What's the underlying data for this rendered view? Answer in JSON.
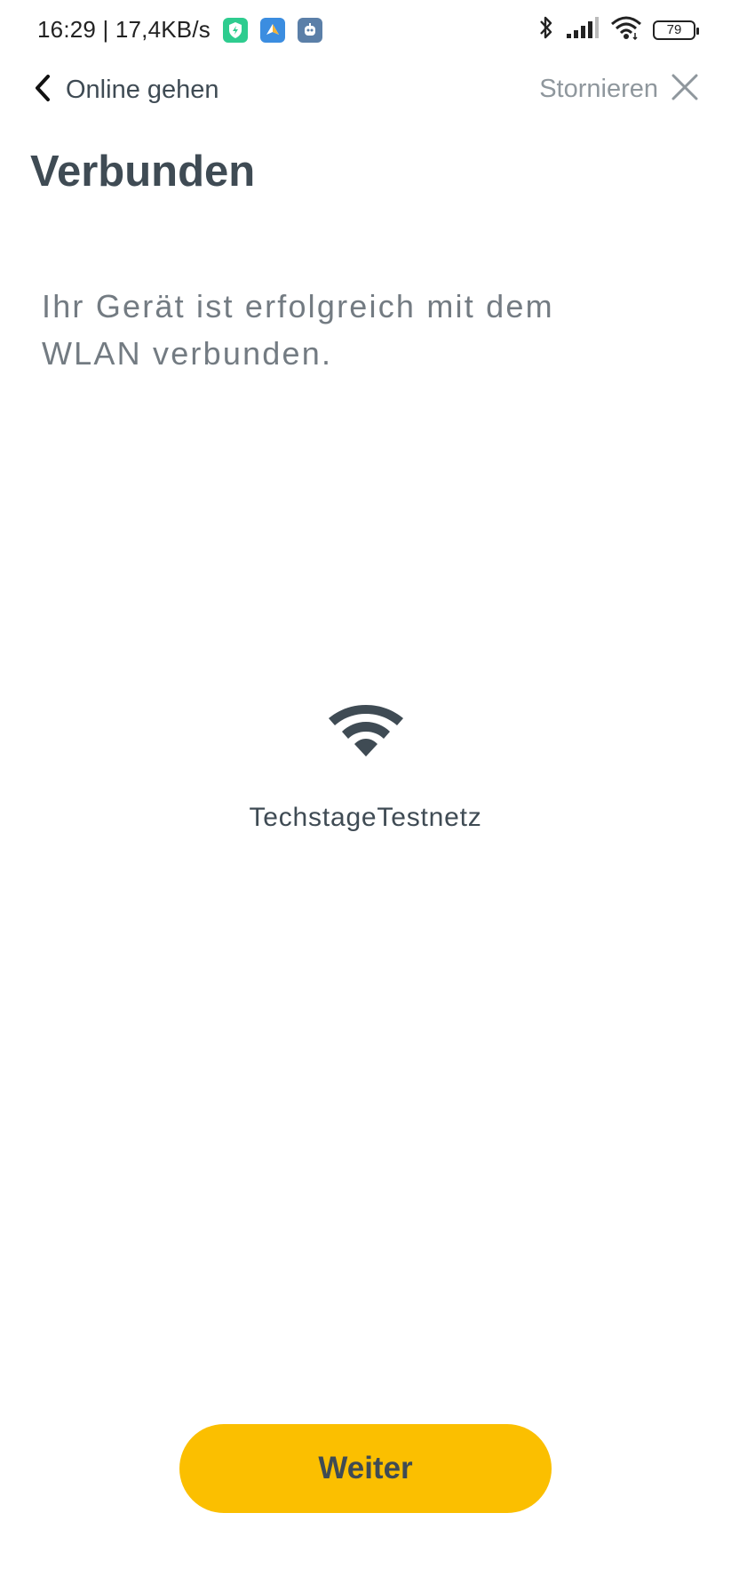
{
  "status_bar": {
    "time_and_speed": "16:29 | 17,4KB/s",
    "battery_level": "79",
    "notification_icons": [
      "shield-app-icon",
      "maps-app-icon",
      "bot-app-icon"
    ],
    "system_icons": [
      "bluetooth-icon",
      "signal-icon",
      "wifi-icon",
      "battery-icon"
    ]
  },
  "nav": {
    "back_label": "Online gehen",
    "cancel_label": "Stornieren",
    "back_icon": "chevron-left-icon",
    "cancel_icon": "close-icon"
  },
  "page": {
    "title": "Verbunden",
    "message": "Ihr Gerät ist erfolgreich mit dem WLAN verbunden."
  },
  "network": {
    "icon": "wifi-icon",
    "name": "TechstageTestnetz"
  },
  "actions": {
    "continue_label": "Weiter"
  },
  "colors": {
    "accent": "#fbbf00",
    "text_primary": "#3f4b54",
    "text_secondary": "#737b82",
    "text_muted": "#8f979d",
    "background": "#ffffff"
  }
}
